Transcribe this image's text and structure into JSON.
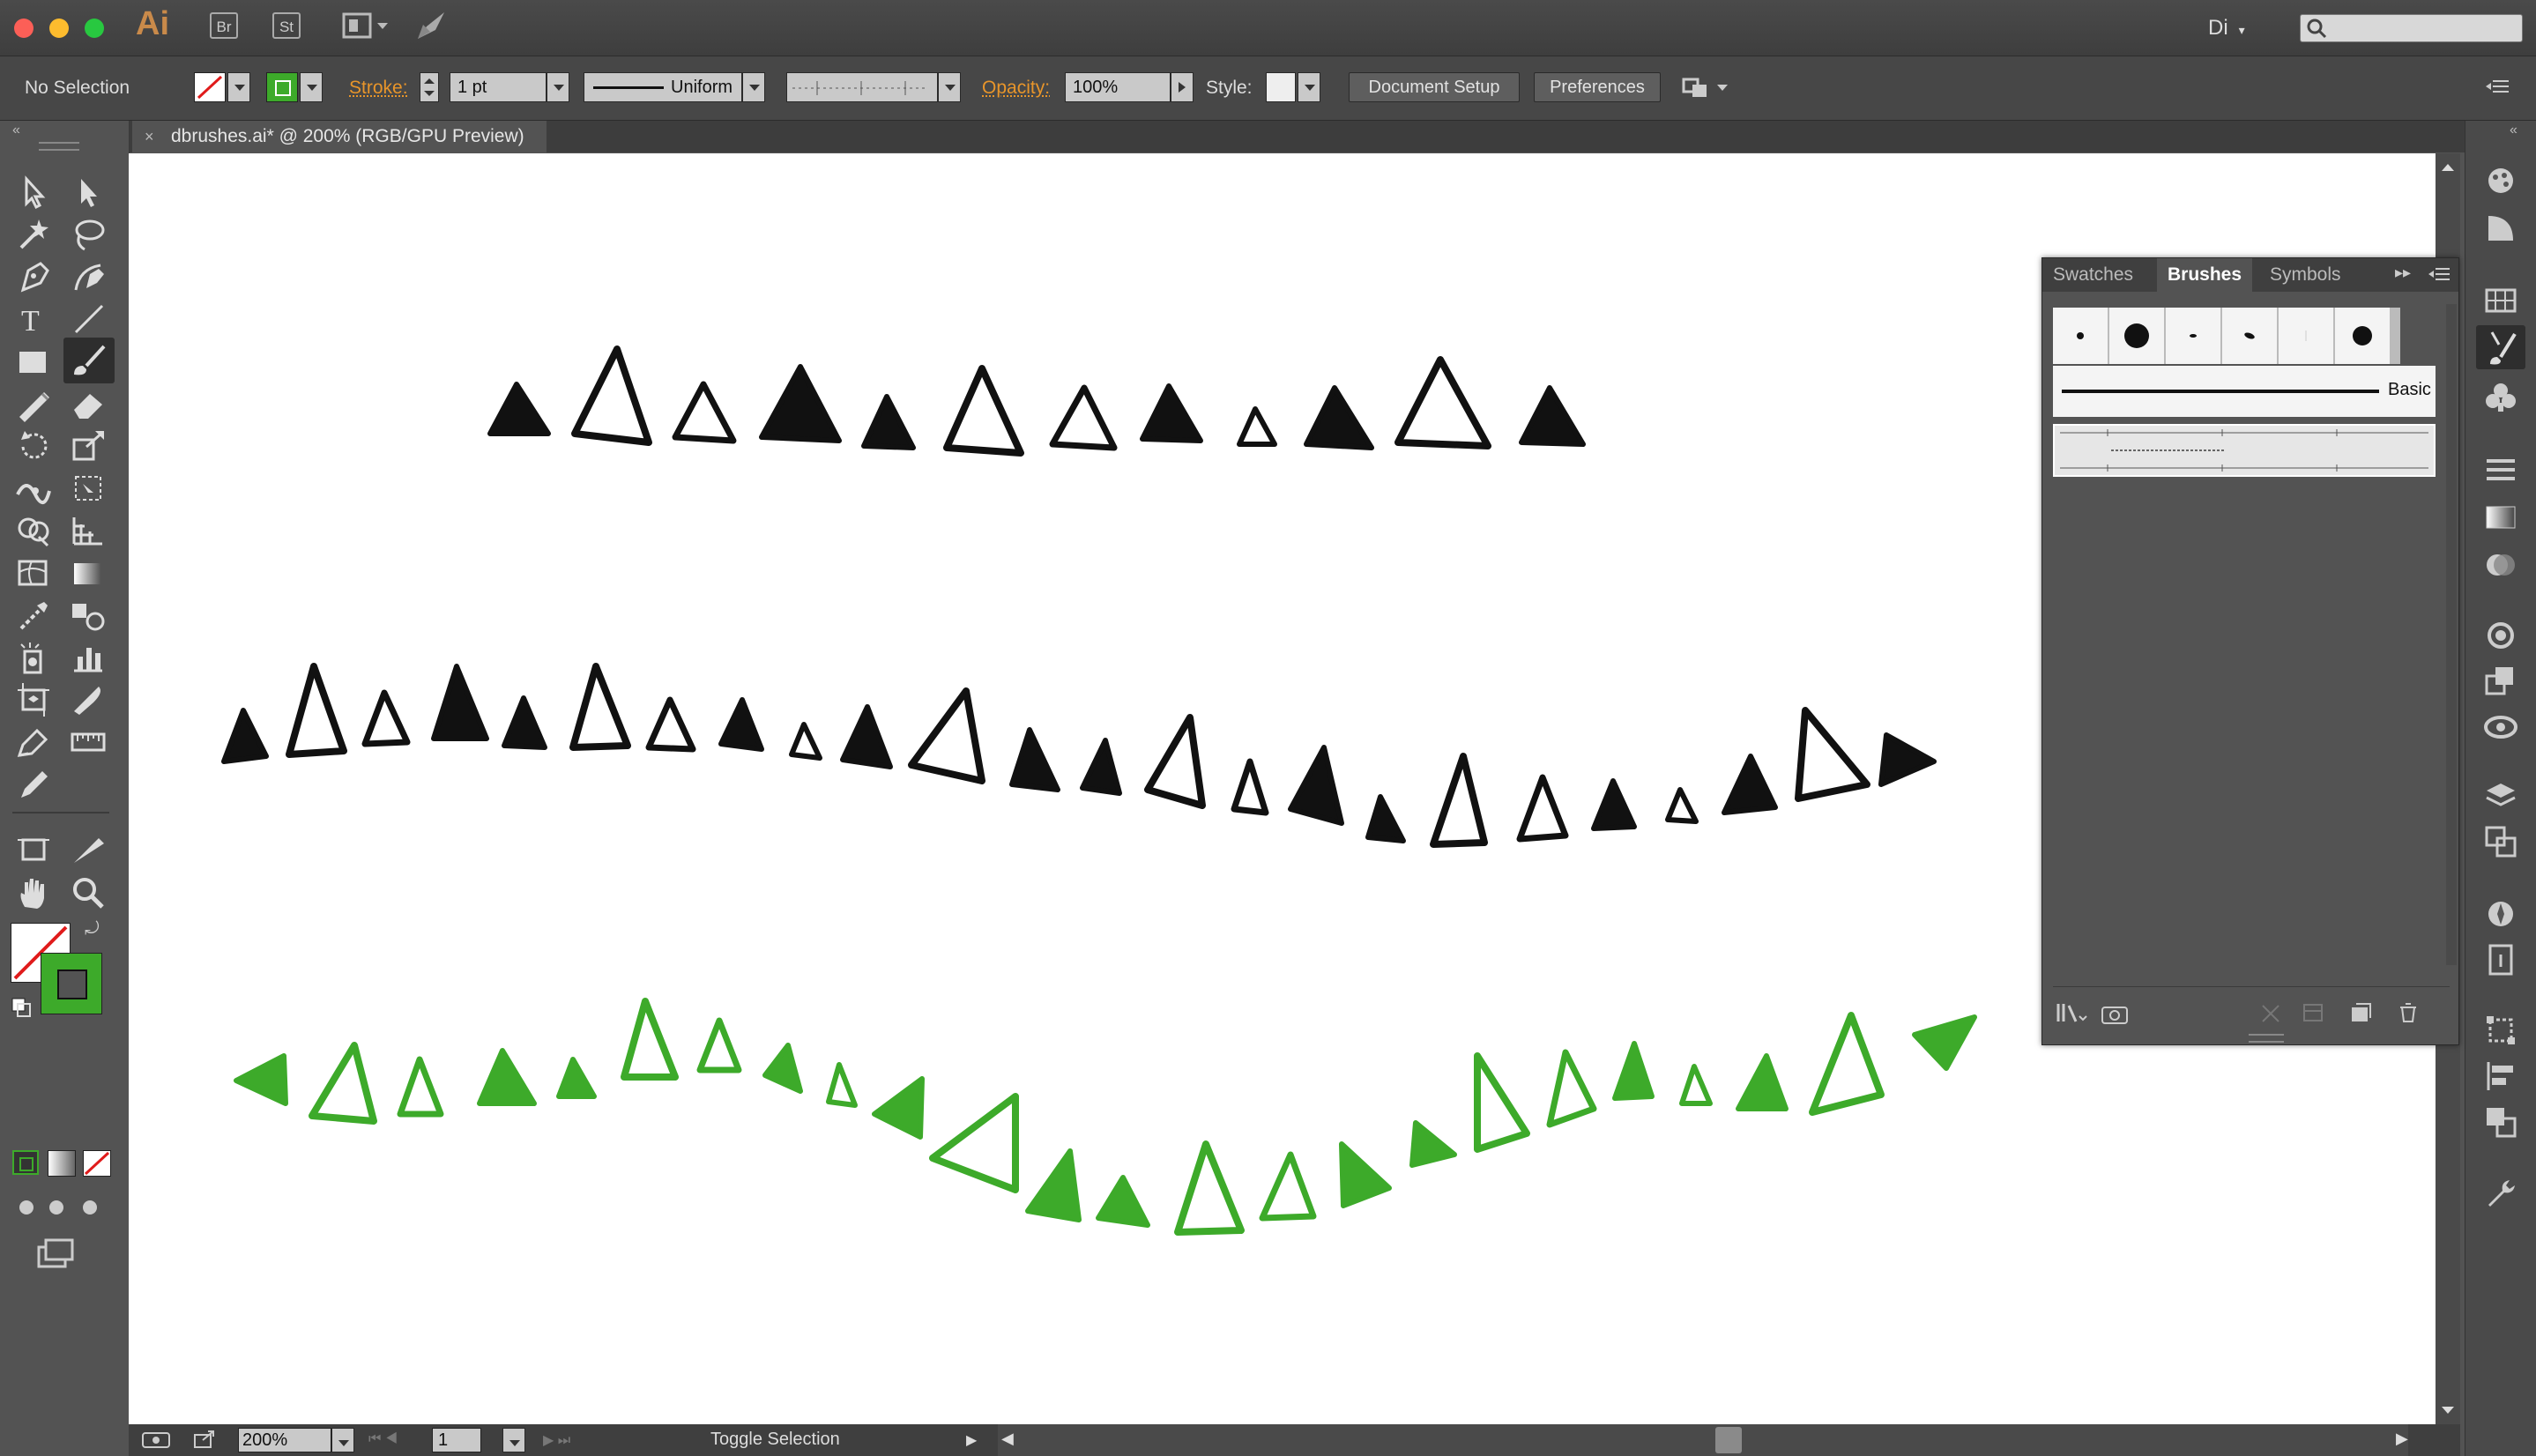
{
  "app": {
    "logo": "Ai",
    "bridge": "Br",
    "stock": "St",
    "workspace": "Di"
  },
  "control": {
    "selection": "No Selection",
    "stroke_label": "Stroke:",
    "stroke_value": "1 pt",
    "profile": "Uniform",
    "opacity_label": "Opacity:",
    "opacity_value": "100%",
    "style_label": "Style:",
    "doc_setup": "Document Setup",
    "preferences": "Preferences"
  },
  "document": {
    "tab_title": "dbrushes.ai* @ 200% (RGB/GPU Preview)"
  },
  "status": {
    "zoom": "200%",
    "page": "1",
    "tool_status": "Toggle Selection"
  },
  "panel": {
    "tabs": [
      "Swatches",
      "Brushes",
      "Symbols"
    ],
    "active_tab": "Brushes",
    "basic_label": "Basic"
  },
  "colors": {
    "green": "#3daa2a",
    "black": "#111111",
    "orange": "#e8952a",
    "stroke_swatch": "#3daa2a"
  }
}
